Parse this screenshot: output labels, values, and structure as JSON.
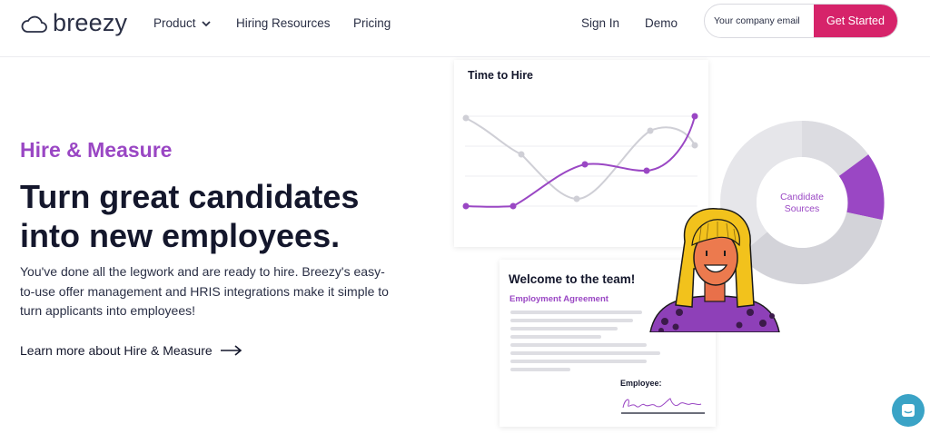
{
  "brand": {
    "name": "breezy"
  },
  "nav": {
    "product": "Product",
    "resources": "Hiring Resources",
    "pricing": "Pricing",
    "signin": "Sign In",
    "demo": "Demo"
  },
  "signup": {
    "placeholder": "Your company email",
    "cta": "Get Started"
  },
  "hero": {
    "eyebrow": "Hire & Measure",
    "headline": "Turn great candidates into new employees.",
    "description": "You've done all the legwork and are ready to hire. Breezy's easy-to-use offer management and HRIS integrations make it simple to turn applicants into employees!",
    "link": "Learn more about Hire & Measure"
  },
  "time_to_hire": {
    "title": "Time to Hire"
  },
  "donut": {
    "label": "Candidate Sources"
  },
  "welcome": {
    "title": "Welcome to the team!",
    "subtitle": "Employment Agreement",
    "employee_label": "Employee:"
  },
  "colors": {
    "accent": "#9a47c4",
    "cta": "#d6236a",
    "chat": "#3aa3c6",
    "text": "#14172c"
  },
  "icons": [
    "cloud-logo-icon",
    "chevron-down-icon",
    "arrow-right-icon",
    "chat-icon"
  ]
}
